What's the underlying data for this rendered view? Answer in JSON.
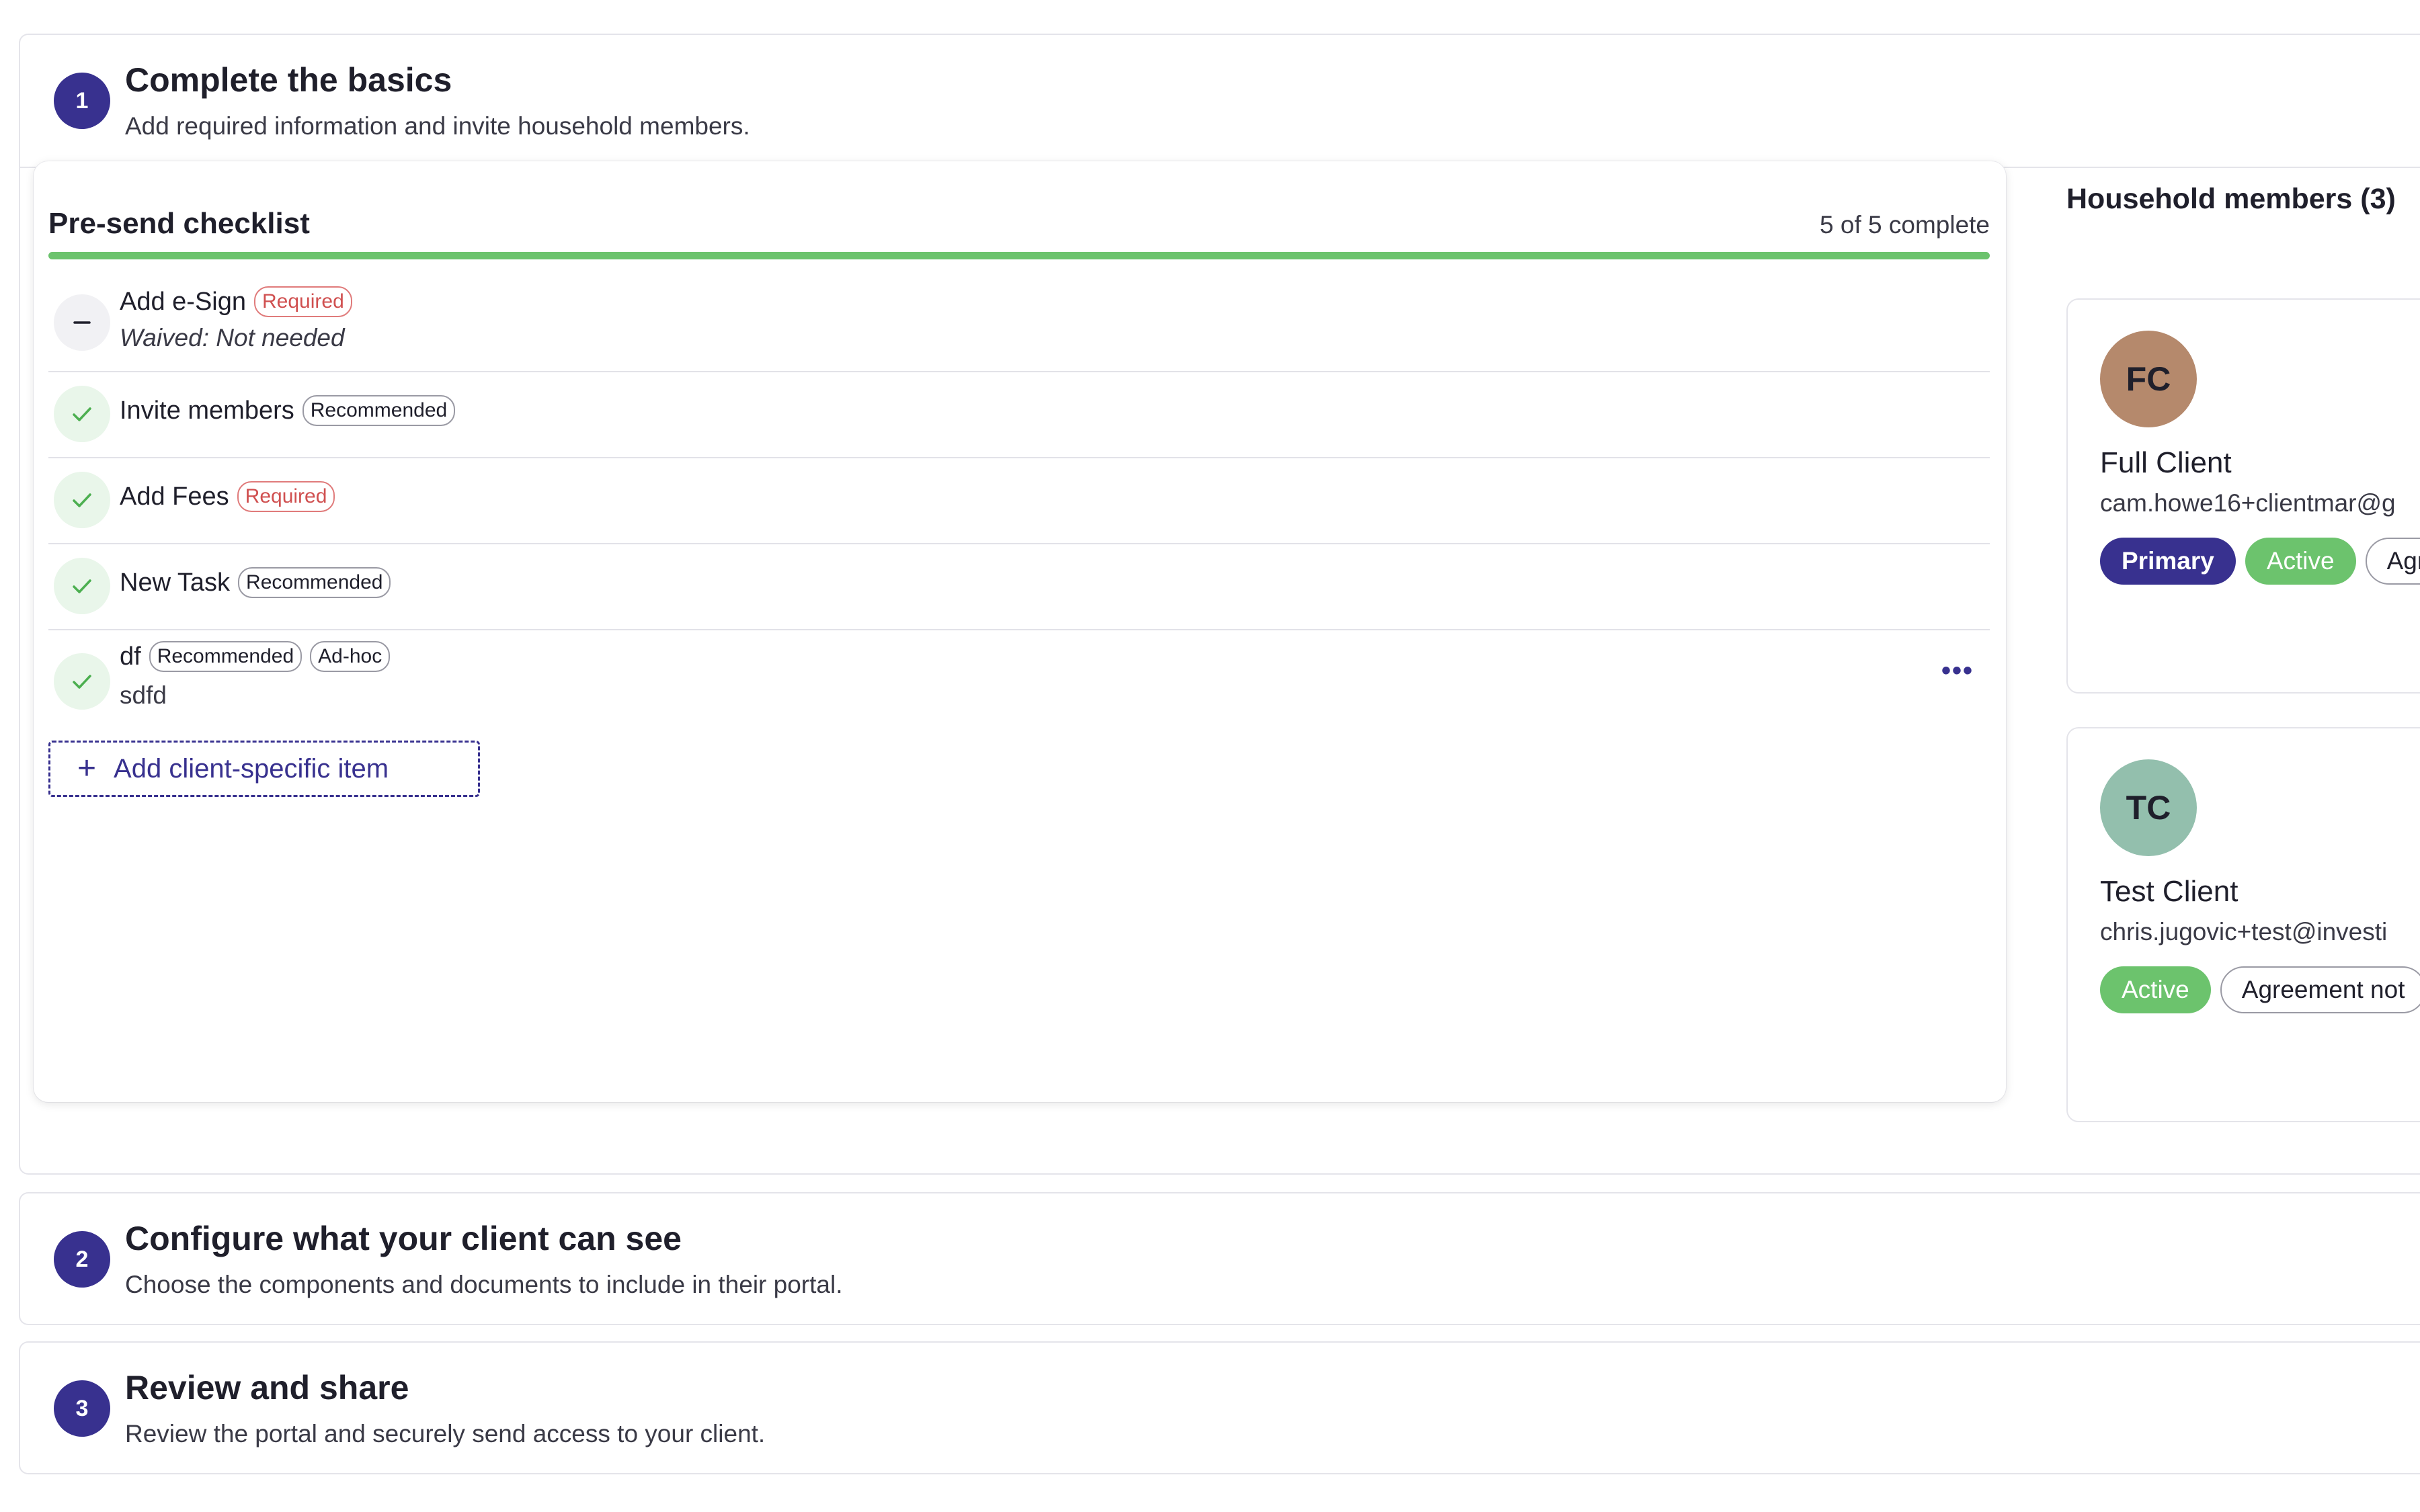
{
  "steps": [
    {
      "number": "1",
      "title": "Complete the basics",
      "subtitle": "Add required information and invite household members."
    },
    {
      "number": "2",
      "title": "Configure what your client can see",
      "subtitle": "Choose the components and documents to include in their portal."
    },
    {
      "number": "3",
      "title": "Review and share",
      "subtitle": "Review the portal and securely send access to your client."
    }
  ],
  "checklist": {
    "title": "Pre-send checklist",
    "status": "5 of 5 complete",
    "progress_fraction": 1.0,
    "progress_color": "#6cc36d",
    "items": [
      {
        "label": "Add e-Sign",
        "badges": [
          "Required"
        ],
        "subtext": "Waived: Not needed",
        "state": "waived",
        "icon": "minus-icon"
      },
      {
        "label": "Invite members",
        "badges": [
          "Recommended"
        ],
        "state": "complete",
        "icon": "check-icon"
      },
      {
        "label": "Add Fees",
        "badges": [
          "Required"
        ],
        "state": "complete",
        "icon": "check-icon"
      },
      {
        "label": "New Task",
        "badges": [
          "Recommended"
        ],
        "state": "complete",
        "icon": "check-icon"
      },
      {
        "label": "df",
        "badges": [
          "Recommended",
          "Ad-hoc"
        ],
        "subtext": "sdfd",
        "state": "complete",
        "icon": "check-icon",
        "more_label": "•••"
      }
    ],
    "add_button": {
      "icon": "+",
      "label": "Add client-specific item"
    }
  },
  "members": {
    "title": "Household members (3)",
    "list": [
      {
        "initials": "FC",
        "avatar_color": "#b5896c",
        "name": "Full Client",
        "email": "cam.howe16+clientmar@g",
        "chips": [
          "Primary",
          "Active",
          "Agr"
        ]
      },
      {
        "initials": "TC",
        "avatar_color": "#93bfad",
        "name": "Test Client",
        "email": "chris.jugovic+test@investi",
        "chips": [
          "Active",
          "Agreement not"
        ]
      }
    ]
  },
  "colors": {
    "accent": "#38318f",
    "success": "#6cc36d",
    "required": "#d05050"
  }
}
